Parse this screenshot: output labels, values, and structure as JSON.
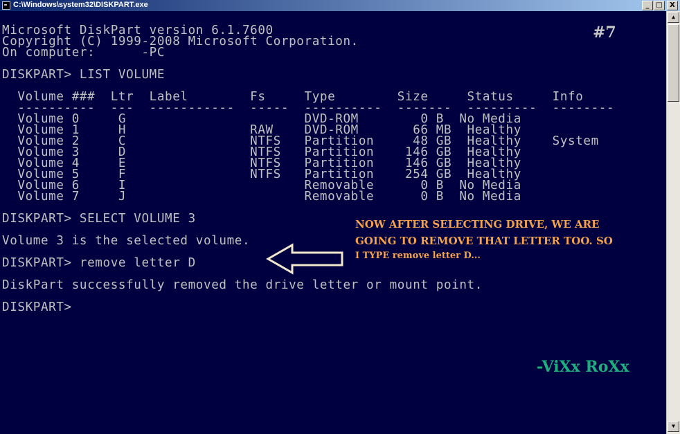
{
  "window": {
    "title": "C:\\Windows\\system32\\DISKPART.exe",
    "controls": {
      "minimize": "_",
      "maximize": "□",
      "close": "X"
    }
  },
  "console": {
    "lines": [
      "Microsoft DiskPart version 6.1.7600",
      "Copyright (C) 1999-2008 Microsoft Corporation.",
      "On computer:      -PC",
      "DISKPART> LIST VOLUME",
      "  Volume ###  Ltr  Label        Fs     Type        Size     Status     Info",
      "  ----------  ---  -----------  -----  ----------  -------  ---------  --------",
      "  Volume 0     G                       DVD-ROM        0 B  No Media",
      "  Volume 1     H                RAW    DVD-ROM       66 MB  Healthy",
      "  Volume 2     C                NTFS   Partition     48 GB  Healthy    System",
      "  Volume 3     D                NTFS   Partition    146 GB  Healthy",
      "  Volume 4     E                NTFS   Partition    146 GB  Healthy",
      "  Volume 5     F                NTFS   Partition    254 GB  Healthy",
      "  Volume 6     I                       Removable      0 B  No Media",
      "  Volume 7     J                       Removable      0 B  No Media",
      "DISKPART> SELECT VOLUME 3",
      "Volume 3 is the selected volume.",
      "DISKPART> remove letter D",
      "DiskPart successfully removed the drive letter or mount point.",
      "DISKPART>"
    ]
  },
  "annotations": {
    "step": "#7",
    "note_lines": [
      "NOW AFTER SELECTING  DRIVE, WE ARE",
      "GOING TO REMOVE THAT LETTER TOO. SO",
      "I TYPE remove letter D..."
    ],
    "signature": "-ViXx RoXx"
  },
  "colors": {
    "console_bg": "#000040",
    "console_text": "#c0c0c0",
    "note_text": "#f5a24b",
    "signature": "#1cb07e"
  },
  "icons": [
    "console-icon",
    "arrow-left-icon",
    "scroll-up-icon",
    "scroll-down-icon"
  ]
}
